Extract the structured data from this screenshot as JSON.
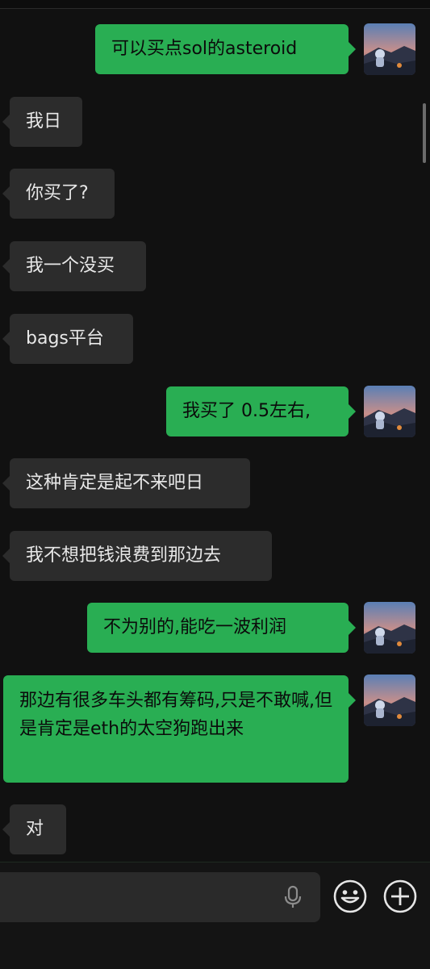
{
  "messages": [
    {
      "side": "out",
      "text": "可以买点sol的asteroid"
    },
    {
      "side": "in",
      "text": "我日"
    },
    {
      "side": "in",
      "text": "你买了?"
    },
    {
      "side": "in",
      "text": "我一个没买"
    },
    {
      "side": "in",
      "text": "bags平台"
    },
    {
      "side": "out",
      "text": "我买了 0.5左右,"
    },
    {
      "side": "in",
      "text": "这种肯定是起不来吧日"
    },
    {
      "side": "in",
      "text": "我不想把钱浪费到那边去"
    },
    {
      "side": "out",
      "text": "不为别的,能吃一波利润"
    },
    {
      "side": "out",
      "text": "那边有很多车头都有筹码,只是不敢喊,但是肯定是eth的太空狗跑出来"
    },
    {
      "side": "in",
      "text": "对"
    }
  ],
  "input_bar": {
    "icons": [
      "microphone-icon",
      "emoji-icon",
      "plus-icon"
    ]
  },
  "colors": {
    "background": "#111111",
    "incoming_bubble": "#2c2c2c",
    "outgoing_bubble": "#29ae53",
    "incoming_text": "#e8e8e8",
    "outgoing_text": "#0b0b0b"
  }
}
